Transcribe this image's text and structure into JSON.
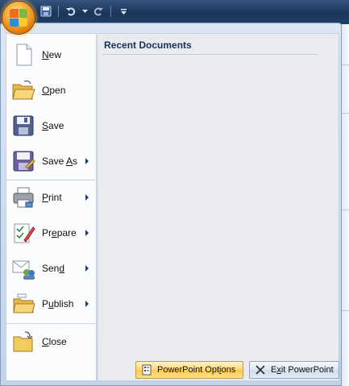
{
  "quick_access": {
    "items": [
      {
        "icon": "floppy-save-icon"
      },
      {
        "icon": "undo-icon"
      },
      {
        "icon": "dropdown-arrow-icon"
      },
      {
        "icon": "redo-icon"
      },
      {
        "icon": "customize-qat-icon"
      }
    ]
  },
  "menu": {
    "items": [
      {
        "label_pre": "",
        "label_key": "N",
        "label_post": "ew",
        "icon": "new-document-icon",
        "submenu": false
      },
      {
        "label_pre": "",
        "label_key": "O",
        "label_post": "pen",
        "icon": "open-folder-icon",
        "submenu": false
      },
      {
        "label_pre": "",
        "label_key": "S",
        "label_post": "ave",
        "icon": "save-disk-icon",
        "submenu": false
      },
      {
        "label_pre": "Save ",
        "label_key": "A",
        "label_post": "s",
        "icon": "save-as-icon",
        "submenu": true
      },
      {
        "label_pre": "",
        "label_key": "P",
        "label_post": "rint",
        "icon": "printer-icon",
        "submenu": true
      },
      {
        "label_pre": "Pr",
        "label_key": "e",
        "label_post": "pare",
        "icon": "prepare-icon",
        "submenu": true
      },
      {
        "label_pre": "Sen",
        "label_key": "d",
        "label_post": "",
        "icon": "send-icon",
        "submenu": true
      },
      {
        "label_pre": "P",
        "label_key": "u",
        "label_post": "blish",
        "icon": "publish-icon",
        "submenu": true
      },
      {
        "label_pre": "",
        "label_key": "C",
        "label_post": "lose",
        "icon": "close-folder-icon",
        "submenu": false
      }
    ]
  },
  "recent": {
    "title": "Recent Documents"
  },
  "buttons": {
    "options": {
      "label_pre": "PowerPoint Opt",
      "label_key": "i",
      "label_post": "ons",
      "icon": "options-icon"
    },
    "exit": {
      "label_pre": "E",
      "label_key": "x",
      "label_post": "it PowerPoint",
      "icon": "exit-x-icon"
    }
  },
  "colors": {
    "accent": "#ffc946",
    "title_bar": "#1c3558",
    "menu_bg": "#dce6f4",
    "recent_pane": "#e9ebee"
  }
}
